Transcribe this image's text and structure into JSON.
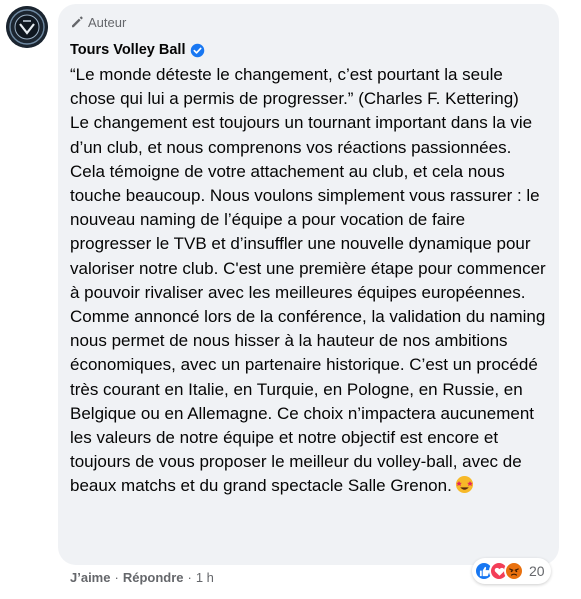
{
  "comment": {
    "badge_label": "Auteur",
    "author_name": "Tours Volley Ball",
    "verified": true,
    "paragraphs": [
      "“Le monde déteste le changement, c’est pourtant la seule chose qui lui a permis de progresser.” (Charles F. Kettering)",
      "Le changement est toujours un tournant important dans la vie d’un club, et nous comprenons vos réactions passionnées. Cela témoigne de votre attachement au club, et cela nous touche beaucoup. Nous voulons simplement vous rassurer : le nouveau naming de l’équipe a pour vocation de faire progresser le TVB et d’insuffler une nouvelle dynamique pour valoriser notre club. C'est une première étape pour commencer à pouvoir rivaliser avec les meilleures équipes européennes. Comme annoncé lors de la conférence, la validation du naming nous permet de nous hisser à la hauteur de nos ambitions économiques, avec un partenaire historique. C’est un procédé très courant en Italie, en Turquie, en Pologne, en Russie, en Belgique ou en Allemagne. Ce choix n’impactera aucunement les valeurs de notre équipe et notre objectif est encore et toujours de vous proposer le meilleur du volley-ball, avec de beaux matchs et du grand spectacle Salle Grenon."
    ],
    "trailing_emoji": "star-struck-emoji"
  },
  "reactions": {
    "icons": [
      "like-icon",
      "love-icon",
      "angry-icon"
    ],
    "count": "20"
  },
  "actions": {
    "like_label": "J’aime",
    "separator": "·",
    "reply_label": "Répondre",
    "time": "1 h"
  },
  "colors": {
    "bubble_bg": "#f0f2f5",
    "secondary_text": "#65676b",
    "verified_blue": "#1877f2",
    "like_blue": "#1877f2",
    "love_red": "#f33e58",
    "angry_orange": "#e9710f"
  }
}
